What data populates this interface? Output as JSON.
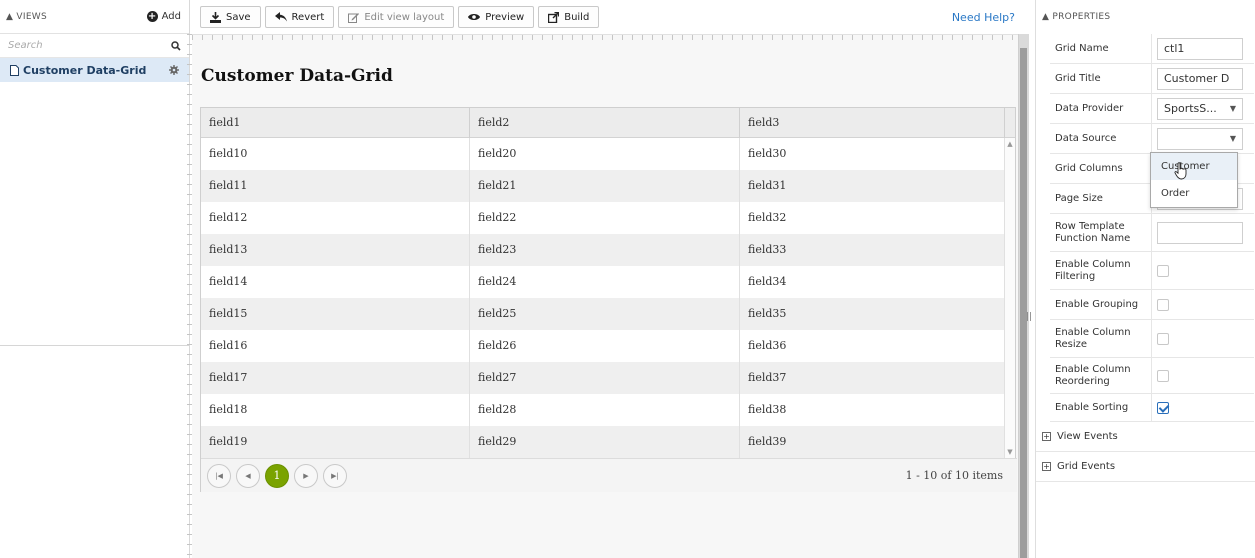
{
  "views_panel": {
    "header": "VIEWS",
    "add_label": "Add",
    "search_placeholder": "Search",
    "items": [
      {
        "label": "Customer Data-Grid"
      }
    ]
  },
  "toolbar": {
    "save_label": "Save",
    "revert_label": "Revert",
    "edit_layout_label": "Edit view layout",
    "preview_label": "Preview",
    "build_label": "Build",
    "help_label": "Need Help?"
  },
  "grid": {
    "title": "Customer Data-Grid",
    "columns": [
      "field1",
      "field2",
      "field3"
    ],
    "rows": [
      [
        "field10",
        "field20",
        "field30"
      ],
      [
        "field11",
        "field21",
        "field31"
      ],
      [
        "field12",
        "field22",
        "field32"
      ],
      [
        "field13",
        "field23",
        "field33"
      ],
      [
        "field14",
        "field24",
        "field34"
      ],
      [
        "field15",
        "field25",
        "field35"
      ],
      [
        "field16",
        "field26",
        "field36"
      ],
      [
        "field17",
        "field27",
        "field37"
      ],
      [
        "field18",
        "field28",
        "field38"
      ],
      [
        "field19",
        "field29",
        "field39"
      ]
    ],
    "pager": {
      "current_page": "1",
      "info": "1 - 10 of 10 items"
    }
  },
  "properties": {
    "header": "PROPERTIES",
    "grid_name_label": "Grid Name",
    "grid_name_value": "ctl1",
    "grid_title_label": "Grid Title",
    "grid_title_value": "Customer D",
    "data_provider_label": "Data Provider",
    "data_provider_value": "SportsS...",
    "data_source_label": "Data Source",
    "data_source_value": "",
    "data_source_options": [
      "Customer",
      "Order"
    ],
    "grid_columns_label": "Grid Columns",
    "page_size_label": "Page Size",
    "row_template_label": "Row Template Function Name",
    "enable_filtering_label": "Enable Column Filtering",
    "enable_filtering": false,
    "enable_grouping_label": "Enable Grouping",
    "enable_grouping": false,
    "enable_resize_label": "Enable Column Resize",
    "enable_resize": false,
    "enable_reorder_label": "Enable Column Reordering",
    "enable_reorder": false,
    "enable_sorting_label": "Enable Sorting",
    "enable_sorting": true,
    "view_events_label": "View Events",
    "grid_events_label": "Grid Events"
  },
  "colors": {
    "accent_link": "#2a78c6",
    "pager_active": "#7aa300",
    "selected_view_bg": "#dde9f6"
  }
}
